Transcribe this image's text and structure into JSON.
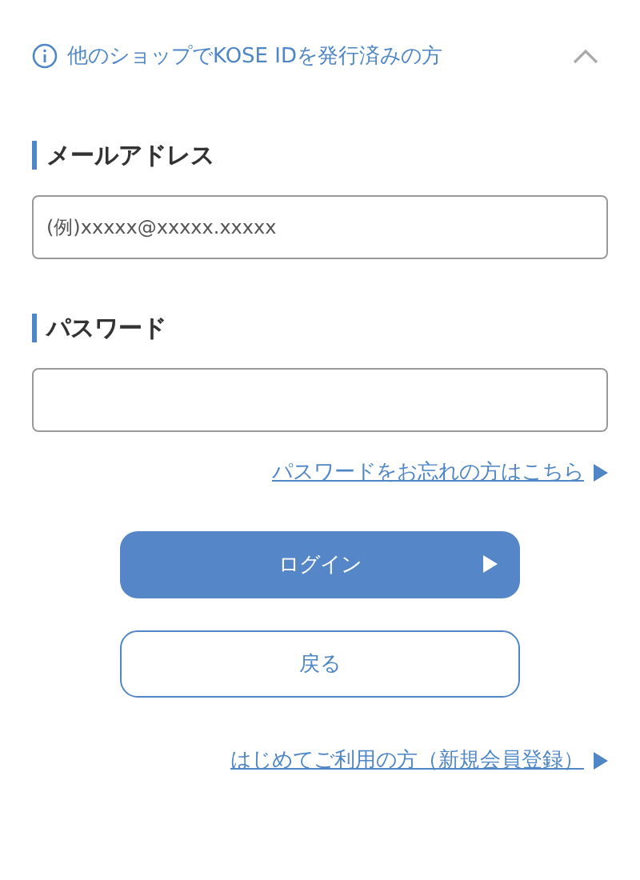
{
  "section": {
    "title": "他のショップでKOSE IDを発行済みの方",
    "expanded": true
  },
  "fields": [
    {
      "label": "メールアドレス",
      "placeholder": "(例)xxxxx@xxxxx.xxxxx"
    },
    {
      "label": "パスワード"
    }
  ],
  "forgot_link": "パスワードをお忘れの方はこちら",
  "buttons": [
    {
      "label": "ログイン",
      "kind": "primary"
    },
    {
      "label": "戻る",
      "kind": "secondary"
    }
  ],
  "register_link": "はじめてご利用の方（新規会員登録）"
}
